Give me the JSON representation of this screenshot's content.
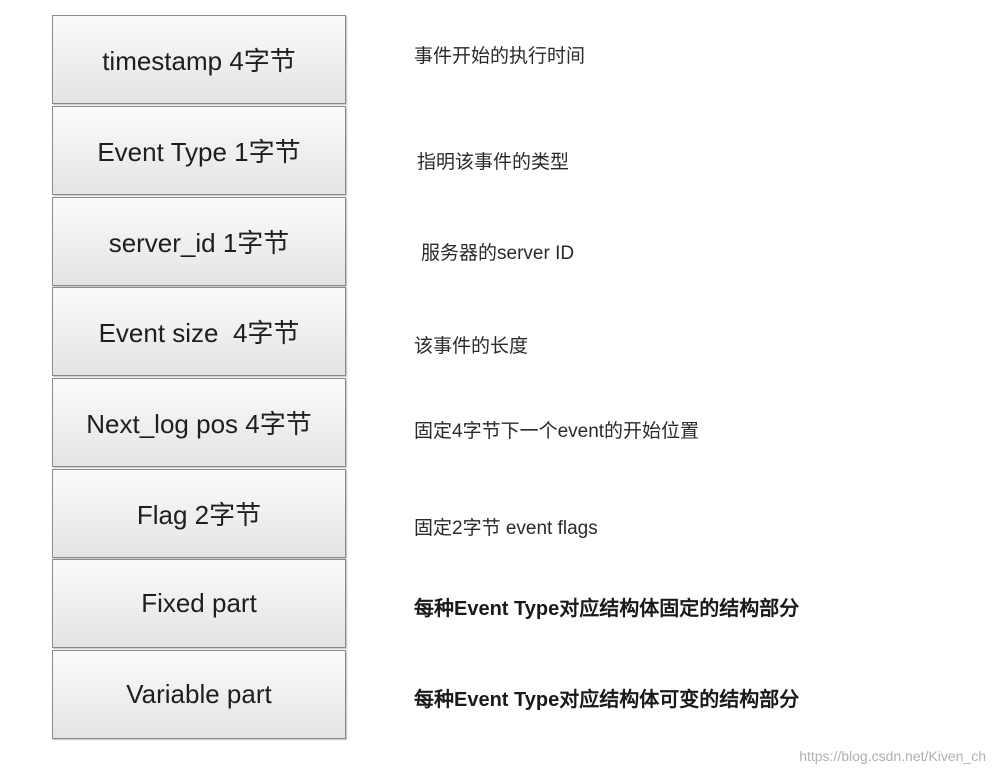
{
  "fields": [
    {
      "label": "timestamp 4字节",
      "description": "事件开始的执行时间"
    },
    {
      "label": "Event Type 1字节",
      "description": "指明该事件的类型"
    },
    {
      "label": "server_id 1字节",
      "description": "服务器的server ID"
    },
    {
      "label": "Event size  4字节",
      "description": "该事件的长度"
    },
    {
      "label": "Next_log pos 4字节",
      "description": "固定4字节下一个event的开始位置"
    },
    {
      "label": "Flag 2字节",
      "description": "固定2字节 event flags"
    },
    {
      "label": "Fixed part",
      "description": "每种Event Type对应结构体固定的结构部分"
    },
    {
      "label": "Variable part",
      "description": "每种Event Type对应结构体可变的结构部分"
    }
  ],
  "watermark": "https://blog.csdn.net/Kiven_ch",
  "colors": {
    "box_border": "#8a8a8a",
    "box_fill_top": "#fbfbfb",
    "box_fill_bottom": "#e4e4e4",
    "text": "#222222",
    "watermark": "#b0b0b0"
  }
}
